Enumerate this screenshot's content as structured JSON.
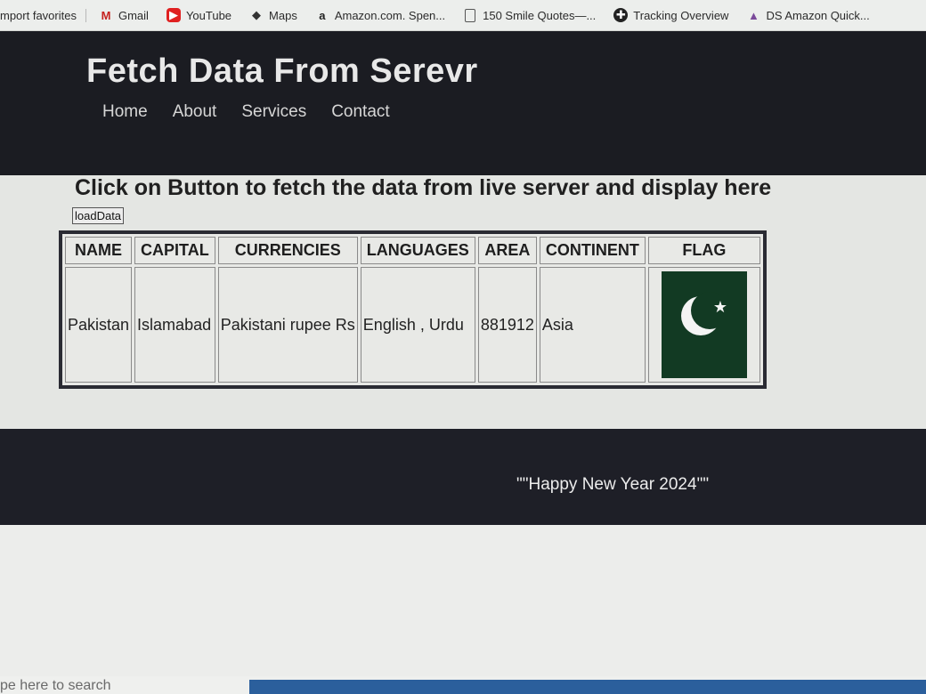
{
  "bookmarks": [
    {
      "label": "mport favorites",
      "icon": "none"
    },
    {
      "label": "Gmail",
      "icon": "gmail-icon"
    },
    {
      "label": "YouTube",
      "icon": "youtube-icon"
    },
    {
      "label": "Maps",
      "icon": "maps-icon"
    },
    {
      "label": "Amazon.com. Spen...",
      "icon": "amazon-icon"
    },
    {
      "label": "150 Smile Quotes—...",
      "icon": "document-icon"
    },
    {
      "label": "Tracking Overview",
      "icon": "tracking-icon"
    },
    {
      "label": "DS Amazon Quick...",
      "icon": "ds-icon"
    }
  ],
  "header": {
    "title": "Fetch Data From Serevr",
    "nav": [
      "Home",
      "About",
      "Services",
      "Contact"
    ]
  },
  "main": {
    "heading": "Click on Button to fetch the data from live server and display here",
    "button_label": "loadData",
    "table": {
      "headers": [
        "NAME",
        "CAPITAL",
        "CURRENCIES",
        "LANGUAGES",
        "AREA",
        "CONTINENT",
        "FLAG"
      ],
      "row": {
        "name": "Pakistan",
        "capital": "Islamabad",
        "currencies": "Pakistani rupee Rs",
        "languages": "English , Urdu",
        "area": "881912",
        "continent": "Asia",
        "flag": "pakistan-flag"
      }
    }
  },
  "footer": {
    "text": "\"\"Happy New Year 2024\"\""
  },
  "taskbar": {
    "search_placeholder": "pe here to search"
  },
  "colors": {
    "header_bg": "#1b1c22",
    "page_bg": "#e4e6e3",
    "flag_green": "#123a23"
  }
}
